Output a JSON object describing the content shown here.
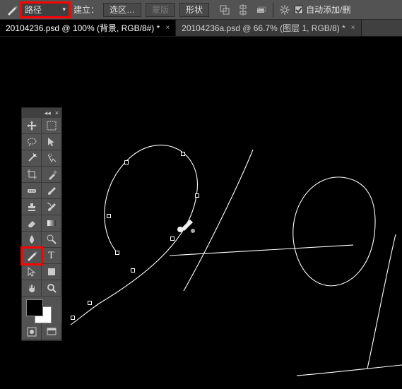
{
  "optionsBar": {
    "mode": "路径",
    "build_label": "建立：",
    "selection_btn": "选区…",
    "mask_btn": "蒙版",
    "shape_btn": "形状",
    "auto_label": "自动添加/删"
  },
  "tabs": {
    "active": "20104236.psd @ 100% (背景, RGB/8#) *",
    "second": "20104236a.psd @ 66.7% (图层 1, RGB/8) *"
  },
  "icons": {
    "pen": "pen-icon",
    "gear": "gear-icon"
  }
}
